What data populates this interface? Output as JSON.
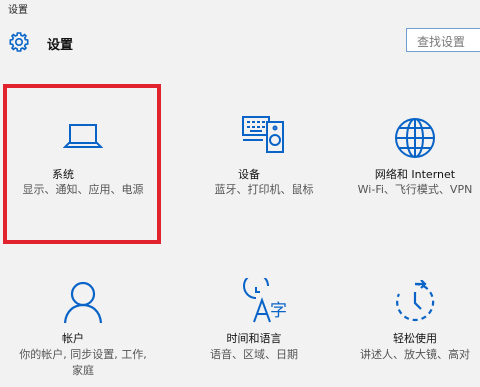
{
  "window": {
    "title": "设置"
  },
  "header": {
    "title": "设置",
    "icon": "gear-icon"
  },
  "search": {
    "placeholder": "查找设置"
  },
  "accent": "#0a64c8",
  "highlight_color": "#e0232d",
  "tiles": [
    {
      "name": "系统",
      "desc": "显示、通知、应用、电源",
      "icon": "laptop-icon",
      "highlighted": true
    },
    {
      "name": "设备",
      "desc": "蓝牙、打印机、鼠标",
      "icon": "devices-icon"
    },
    {
      "name": "网络和 Internet",
      "desc": "Wi-Fi、飞行模式、VPN",
      "icon": "globe-icon"
    },
    {
      "name": "帐户",
      "desc": "你的帐户, 同步设置, 工作, 家庭",
      "icon": "person-icon"
    },
    {
      "name": "时间和语言",
      "desc": "语音、区域、日期",
      "icon": "time-language-icon"
    },
    {
      "name": "轻松使用",
      "desc": "讲述人、放大镜、高对",
      "icon": "ease-of-access-icon"
    }
  ]
}
